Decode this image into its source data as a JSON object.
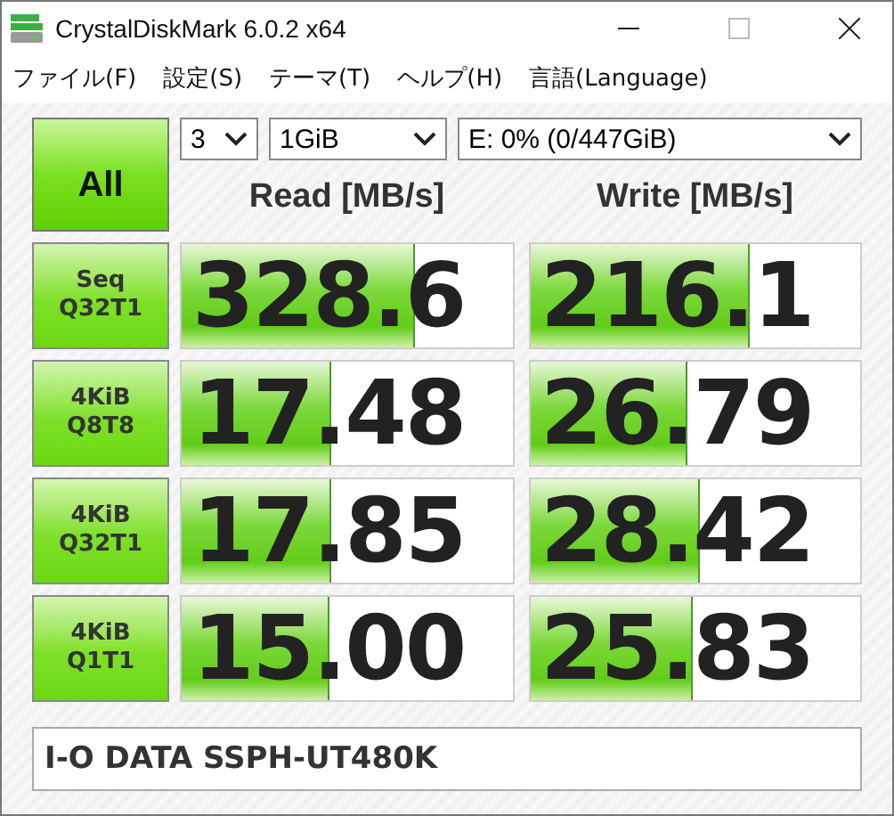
{
  "window": {
    "title": "CrystalDiskMark 6.0.2 x64"
  },
  "menu": [
    "ファイル(F)",
    "設定(S)",
    "テーマ(T)",
    "ヘルプ(H)",
    "言語(Language)"
  ],
  "all_button": "All",
  "selects": [
    {
      "value": "3"
    },
    {
      "value": "1GiB"
    },
    {
      "value": "E: 0% (0/447GiB)"
    }
  ],
  "headers": [
    "Read [MB/s]",
    "Write [MB/s]"
  ],
  "rows": [
    {
      "test": [
        "Seq",
        "Q32T1"
      ],
      "read": {
        "value": "328.6",
        "level": 0.7
      },
      "write": {
        "value": "216.1",
        "level": 0.66
      }
    },
    {
      "test": [
        "4KiB",
        "Q8T8"
      ],
      "read": {
        "value": "17.48",
        "level": 0.45
      },
      "write": {
        "value": "26.79",
        "level": 0.47
      }
    },
    {
      "test": [
        "4KiB",
        "Q32T1"
      ],
      "read": {
        "value": "17.85",
        "level": 0.45
      },
      "write": {
        "value": "28.42",
        "level": 0.51
      }
    },
    {
      "test": [
        "4KiB",
        "Q1T1"
      ],
      "read": {
        "value": "15.00",
        "level": 0.44
      },
      "write": {
        "value": "25.83",
        "level": 0.49
      }
    }
  ],
  "comment": "I-O DATA SSPH-UT480K"
}
